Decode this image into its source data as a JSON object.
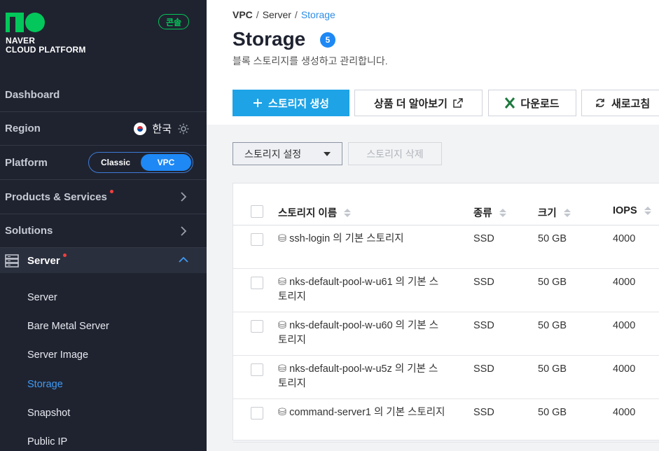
{
  "sidebar": {
    "brand_line1": "NAVER",
    "brand_line2": "CLOUD PLATFORM",
    "console_badge": "콘솔",
    "dashboard": "Dashboard",
    "region": {
      "label": "Region",
      "value": "한국"
    },
    "platform": {
      "label": "Platform",
      "options": [
        "Classic",
        "VPC"
      ],
      "selected": "VPC"
    },
    "products": "Products & Services",
    "solutions": "Solutions",
    "server": "Server",
    "sub_items": [
      "Server",
      "Bare Metal Server",
      "Server Image",
      "Storage",
      "Snapshot",
      "Public IP"
    ],
    "active_sub_item": "Storage"
  },
  "breadcrumb": [
    "VPC",
    "Server",
    "Storage"
  ],
  "page": {
    "title": "Storage",
    "count": "5",
    "subtitle": "블록 스토리지를 생성하고 관리합니다."
  },
  "toolbar": {
    "create": "스토리지 생성",
    "learn_more": "상품 더 알아보기",
    "download": "다운로드",
    "refresh": "새로고침"
  },
  "actions": {
    "settings": "스토리지 설정",
    "delete": "스토리지 삭제"
  },
  "table": {
    "columns": [
      "스토리지 이름",
      "종류",
      "크기",
      "IOPS"
    ],
    "rows": [
      {
        "name": "ssh-login 의 기본 스토리지",
        "type": "SSD",
        "size": "50 GB",
        "iops": "4000"
      },
      {
        "name": "nks-default-pool-w-u61 의 기본 스토리지",
        "type": "SSD",
        "size": "50 GB",
        "iops": "4000"
      },
      {
        "name": "nks-default-pool-w-u60 의 기본 스토리지",
        "type": "SSD",
        "size": "50 GB",
        "iops": "4000"
      },
      {
        "name": "nks-default-pool-w-u5z 의 기본 스토리지",
        "type": "SSD",
        "size": "50 GB",
        "iops": "4000"
      },
      {
        "name": "command-server1 의 기본 스토리지",
        "type": "SSD",
        "size": "50 GB",
        "iops": "4000"
      }
    ]
  },
  "colors": {
    "sidebar_bg": "#1f2330",
    "naver_green": "#03c75a",
    "accent_blue": "#1ea3e6",
    "active_link": "#3f9bf5"
  }
}
